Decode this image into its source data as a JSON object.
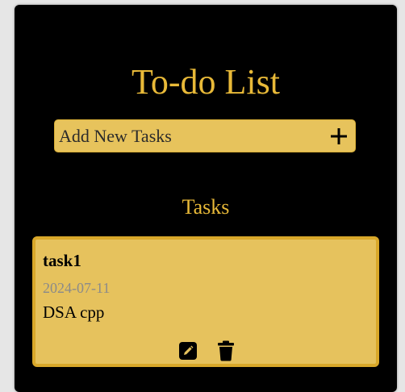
{
  "app": {
    "title": "To-do List"
  },
  "add_task": {
    "placeholder": "Add New Tasks",
    "value": "",
    "button_icon": "plus-icon"
  },
  "tasks_section": {
    "title": "Tasks",
    "tasks": [
      {
        "name": "task1",
        "date": "2024-07-11",
        "description": "DSA cpp",
        "actions": [
          "edit-icon",
          "trash-icon"
        ]
      }
    ]
  },
  "colors": {
    "background": "#000000",
    "accent": "#e8b938",
    "input_bg": "#e7c35c",
    "card_bg": "#e6c25d",
    "card_border": "#d9a82a",
    "date_text": "#8a8a8a"
  }
}
